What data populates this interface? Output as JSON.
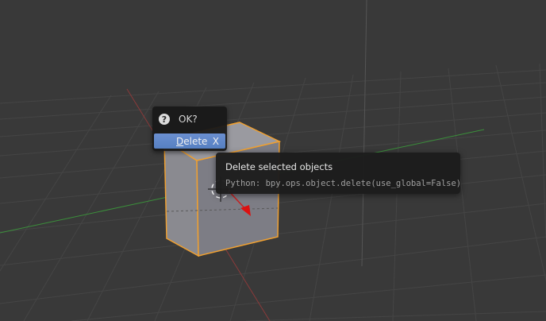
{
  "confirm_menu": {
    "title": "OK?",
    "help_icon": "?",
    "delete_label_first": "D",
    "delete_label_rest": "elete",
    "delete_shortcut": "X"
  },
  "tooltip": {
    "title": "Delete selected objects",
    "python": "Python: bpy.ops.object.delete(use_global=False)"
  },
  "colors": {
    "viewport_background": "#393939",
    "grid_line": "#4a4a4a",
    "x_axis": "#d04040",
    "y_axis": "#3aa03a",
    "z_axis": "#5a5a5a",
    "cube_face": "#8c8c92",
    "selection_outline": "#f0a030",
    "menu_highlight": "#5680c2"
  },
  "icons": {
    "help": "question-circle-icon",
    "cursor": "3d-cursor-icon",
    "origin": "object-origin-icon"
  }
}
